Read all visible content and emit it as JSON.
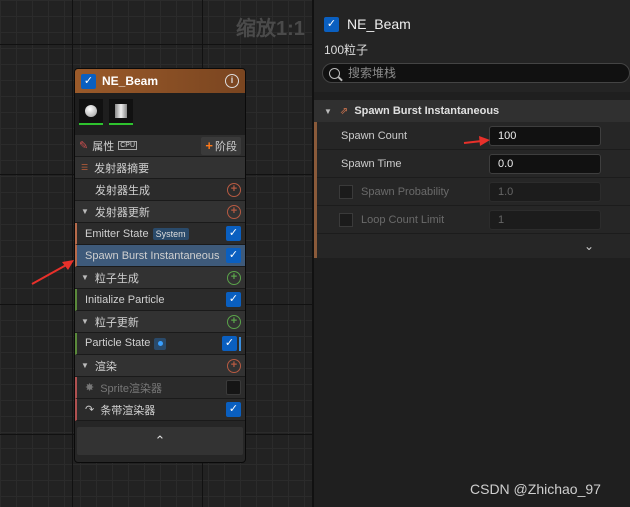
{
  "graph": {
    "zoom_label": "缩放1:1"
  },
  "node": {
    "title": "NE_Beam",
    "enabled": true,
    "props_label": "属性",
    "sim_badge": "CPU",
    "stage_button": "阶段",
    "rows": [
      {
        "label": "发射器摘要",
        "type": "summary"
      },
      {
        "label": "发射器生成",
        "type": "sub"
      },
      {
        "label": "发射器更新",
        "type": "section"
      },
      {
        "label": "Emitter State",
        "badge": "System",
        "checked": true
      },
      {
        "label": "Spawn Burst Instantaneous",
        "checked": true,
        "selected": true
      },
      {
        "label": "粒子生成",
        "type": "section"
      },
      {
        "label": "Initialize Particle",
        "checked": true
      },
      {
        "label": "粒子更新",
        "type": "section"
      },
      {
        "label": "Particle State",
        "checked": true
      },
      {
        "label": "渲染",
        "type": "section"
      },
      {
        "label": "Sprite渲染器",
        "checked": false
      },
      {
        "label": "条带渲染器",
        "checked": true
      }
    ]
  },
  "panel": {
    "title": "NE_Beam",
    "subtitle": "100粒子",
    "search_placeholder": "搜索堆栈",
    "section_title": "Spawn Burst Instantaneous",
    "fields": [
      {
        "label": "Spawn Count",
        "value": "100"
      },
      {
        "label": "Spawn Time",
        "value": "0.0"
      },
      {
        "label": "Spawn Probability",
        "value": "1.0"
      },
      {
        "label": "Loop Count Limit",
        "value": "1"
      }
    ]
  },
  "watermark": "CSDN @Zhichao_97",
  "colors": {
    "annotation_arrow": "#e8302a",
    "checkbox": "#0a5fc0",
    "selection": "#3e5a7a"
  }
}
